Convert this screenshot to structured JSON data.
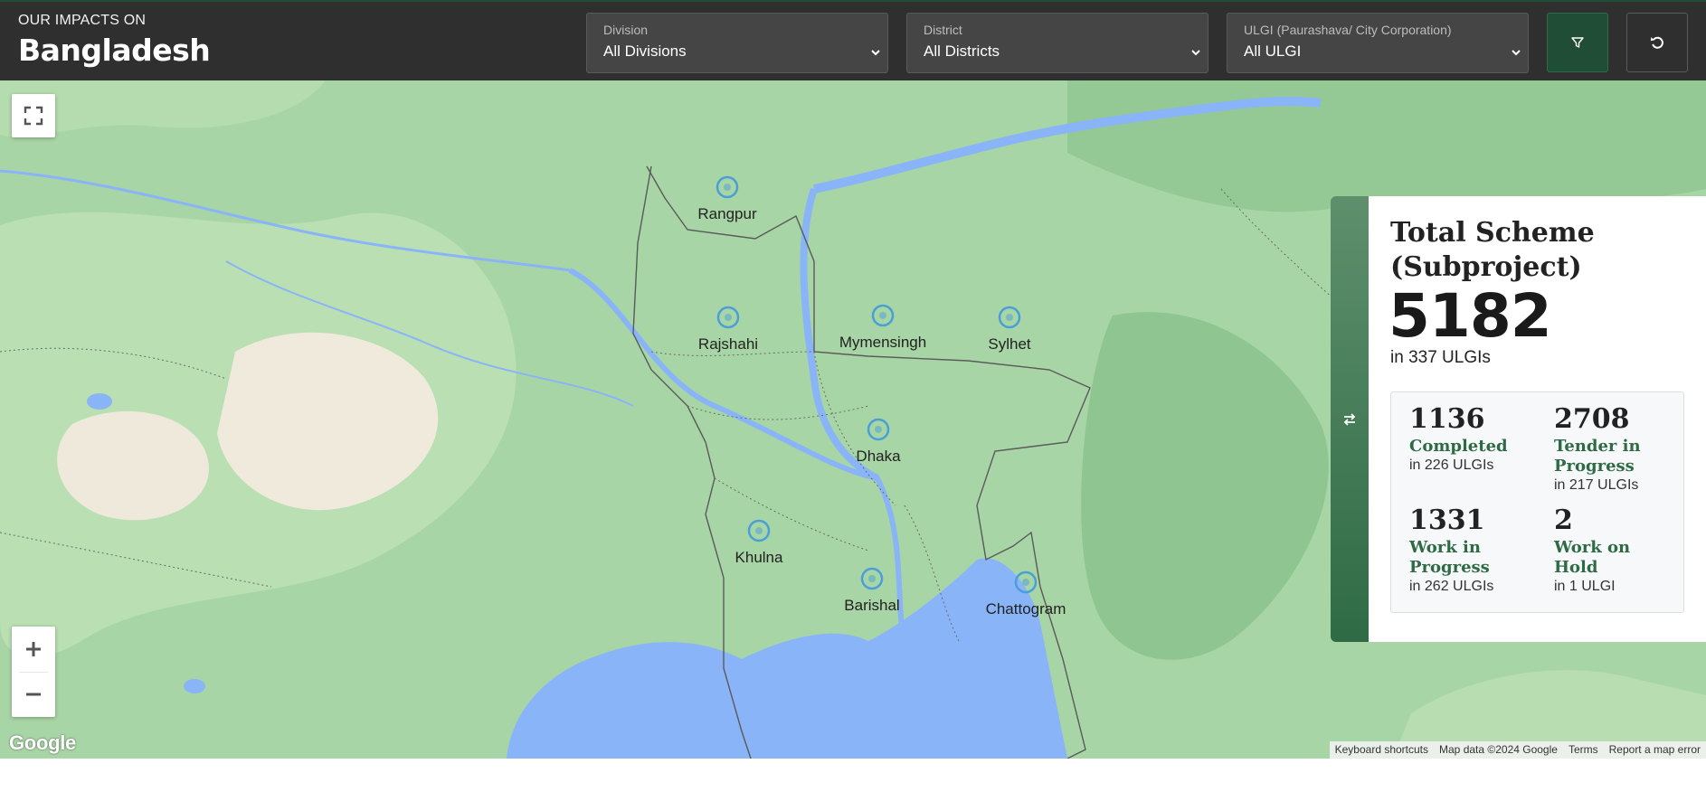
{
  "header": {
    "kicker": "OUR IMPACTS ON",
    "title": "Bangladesh"
  },
  "filters": {
    "division": {
      "label": "Division",
      "value": "All Divisions"
    },
    "district": {
      "label": "District",
      "value": "All Districts"
    },
    "ulgi": {
      "label": "ULGI (Paurashava/ City Corporation)",
      "value": "All ULGI"
    },
    "filter_button_icon": "filter-icon",
    "reset_button_icon": "reset-icon"
  },
  "map": {
    "regions": [
      {
        "name": "Rangpur"
      },
      {
        "name": "Rajshahi"
      },
      {
        "name": "Mymensingh"
      },
      {
        "name": "Sylhet"
      },
      {
        "name": "Dhaka"
      },
      {
        "name": "Khulna"
      },
      {
        "name": "Barishal"
      },
      {
        "name": "Chattogram"
      }
    ],
    "logo": "Google",
    "attribution": {
      "shortcuts": "Keyboard shortcuts",
      "data": "Map data ©2024 Google",
      "terms": "Terms",
      "report": "Report a map error"
    },
    "colors": {
      "land": "#a8d5a5",
      "water": "#8ab4f8",
      "marker": "#4a9fd8"
    }
  },
  "stats": {
    "title": "Total Scheme (Subproject)",
    "total": "5182",
    "total_sub": "in 337 ULGIs",
    "items": [
      {
        "value": "1136",
        "label": "Completed",
        "sub": "in 226 ULGIs"
      },
      {
        "value": "2708",
        "label": "Tender in Progress",
        "sub": "in 217 ULGIs"
      },
      {
        "value": "1331",
        "label": "Work in Progress",
        "sub": "in 262 ULGIs"
      },
      {
        "value": "2",
        "label": "Work on Hold",
        "sub": "in 1 ULGI"
      }
    ],
    "toggle_icon": "swap-icon"
  }
}
